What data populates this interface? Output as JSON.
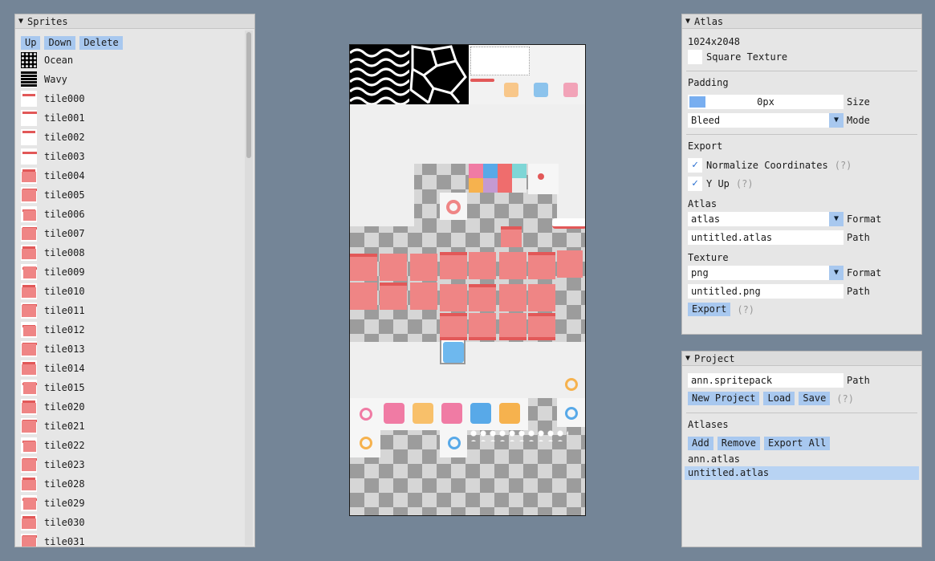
{
  "sprites_window": {
    "title": "Sprites",
    "buttons": {
      "up": "Up",
      "down": "Down",
      "delete": "Delete"
    },
    "items": [
      "Ocean",
      "Wavy",
      "tile000",
      "tile001",
      "tile002",
      "tile003",
      "tile004",
      "tile005",
      "tile006",
      "tile007",
      "tile008",
      "tile009",
      "tile010",
      "tile011",
      "tile012",
      "tile013",
      "tile014",
      "tile015",
      "tile020",
      "tile021",
      "tile022",
      "tile023",
      "tile028",
      "tile029",
      "tile030",
      "tile031"
    ]
  },
  "atlas_window": {
    "title": "Atlas",
    "dimensions": "1024x2048",
    "square_texture_label": "Square Texture",
    "padding_header": "Padding",
    "padding_value": "0px",
    "padding_size_label": "Size",
    "mode_value": "Bleed",
    "mode_label": "Mode",
    "export_header": "Export",
    "normalize_label": "Normalize Coordinates",
    "yup_label": "Y Up",
    "help": "(?)",
    "atlas_header": "Atlas",
    "atlas_format_value": "atlas",
    "format_label": "Format",
    "atlas_path_value": "untitled.atlas",
    "path_label": "Path",
    "texture_header": "Texture",
    "texture_format_value": "png",
    "texture_path_value": "untitled.png",
    "export_button": "Export"
  },
  "project_window": {
    "title": "Project",
    "path_value": "ann.spritepack",
    "path_label": "Path",
    "new_project": "New Project",
    "load": "Load",
    "save": "Save",
    "help": "(?)",
    "atlases_header": "Atlases",
    "add": "Add",
    "remove": "Remove",
    "export_all": "Export All",
    "atlases": [
      "ann.atlas",
      "untitled.atlas"
    ]
  },
  "colors": {
    "accent": "#a8c8ef",
    "selected": "#b8d3f3",
    "tile_red": "#ef8585",
    "background": "#748597"
  }
}
